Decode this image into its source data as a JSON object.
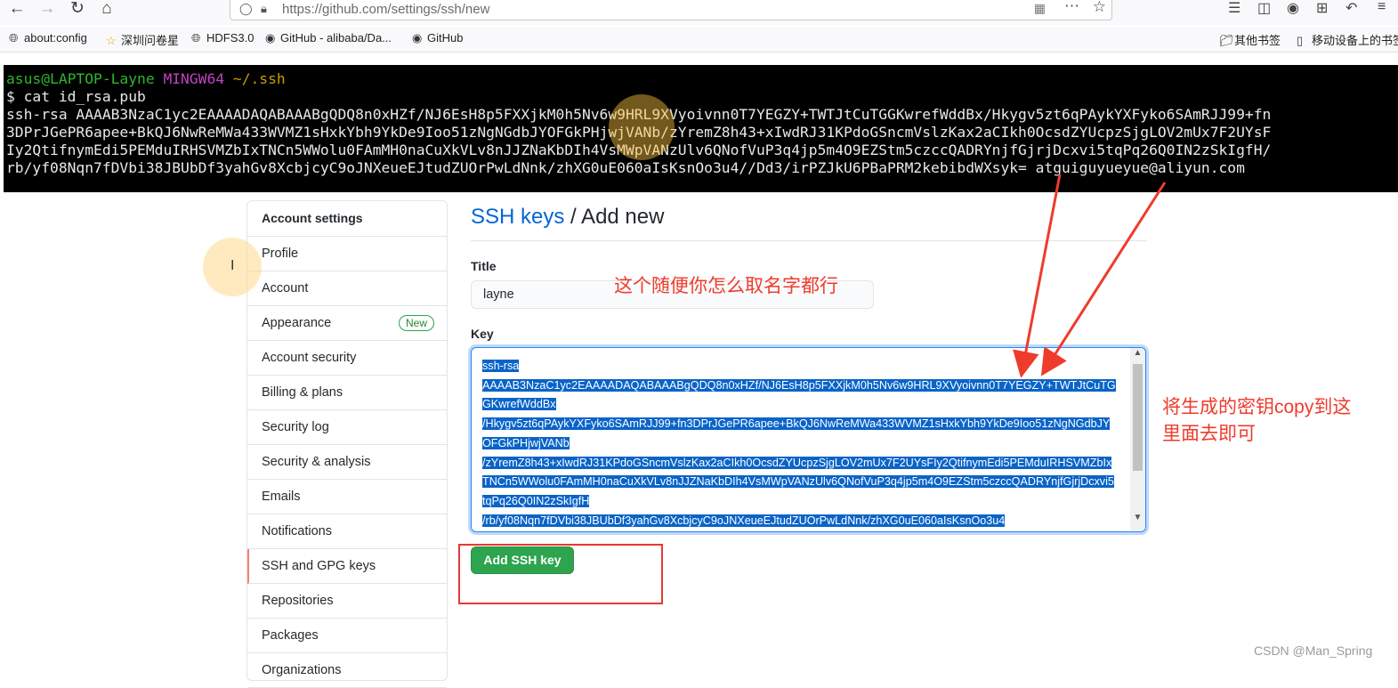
{
  "browser": {
    "url": "https://github.com/settings/ssh/new",
    "bookmarks": [
      "about:config",
      "深圳问卷星",
      "HDFS3.0",
      "GitHub - alibaba/Da...",
      "GitHub"
    ],
    "bookmarks_right": [
      "其他书签",
      "移动设备上的书签"
    ]
  },
  "terminal": {
    "prompt_user": "asus@LAPTOP-Layne",
    "prompt_sys": "MINGW64",
    "prompt_path": "~/.ssh",
    "command": "$ cat id_rsa.pub",
    "output_lines": [
      "ssh-rsa AAAAB3NzaC1yc2EAAAADAQABAAABgQDQ8n0xHZf/NJ6EsH8p5FXXjkM0h5Nv6w9HRL9XVyoivnn0T7YEGZY+TWTJtCuTGGKwrefWddBx/Hkygv5zt6qPAykYXFyko6SAmRJJ99+fn",
      "3DPrJGePR6apee+BkQJ6NwReMWa433WVMZ1sHxkYbh9YkDe9Ioo51zNgNGdbJYOFGkPHjwjVANb/zYremZ8h43+xIwdRJ31KPdoGSncmVslzKax2aCIkh0OcsdZYUcpzSjgLOV2mUx7F2UYsF",
      "Iy2QtifnymEdi5PEMduIRHSVMZbIxTNCn5WWolu0FAmMH0naCuXkVLv8nJJZNaKbDIh4VsMWpVANzUlv6QNofVuP3q4jp5m4O9EZStm5czccQADRYnjfGjrjDcxvi5tqPq26Q0IN2zSkIgfH/",
      "rb/yf08Nqn7fDVbi38JBUbDf3yahGv8XcbjcyC9oJNXeueEJtudZUOrPwLdNnk/zhXG0uE060aIsKsnOo3u4//Dd3/irPZJkU6PBaPRM2kebibdWXsyk= atguiguyueyue@aliyun.com"
    ]
  },
  "sidebar": {
    "header": "Account settings",
    "items": [
      {
        "label": "Profile"
      },
      {
        "label": "Account"
      },
      {
        "label": "Appearance",
        "badge": "New"
      },
      {
        "label": "Account security"
      },
      {
        "label": "Billing & plans"
      },
      {
        "label": "Security log"
      },
      {
        "label": "Security & analysis"
      },
      {
        "label": "Emails"
      },
      {
        "label": "Notifications"
      },
      {
        "label": "SSH and GPG keys",
        "selected": true
      },
      {
        "label": "Repositories"
      },
      {
        "label": "Packages"
      },
      {
        "label": "Organizations"
      }
    ]
  },
  "main": {
    "title_link": "SSH keys",
    "title_rest": " / Add new",
    "title_label": "Title",
    "title_value": "layne",
    "key_label": "Key",
    "key_lines": [
      "ssh-rsa",
      "AAAAB3NzaC1yc2EAAAADAQABAAABgQDQ8n0xHZf/NJ6EsH8p5FXXjkM0h5Nv6w9HRL9XVyoivnn0T7YEGZY+TWTJtCuTGGKwrefWddBx",
      "/Hkygv5zt6qPAykYXFyko6SAmRJJ99+fn3DPrJGePR6apee+BkQJ6NwReMWa433WVMZ1sHxkYbh9YkDe9Ioo51zNgNGdbJYOFGkPHjwjVANb",
      "/zYremZ8h43+xIwdRJ31KPdoGSncmVslzKax2aCIkh0OcsdZYUcpzSjgLOV2mUx7F2UYsFIy2QtifnymEdi5PEMduIRHSVMZbIxTNCn5WWolu0FAmMH0naCuXkVLv8nJJZNaKbDIh4VsMWpVANzUlv6QNofVuP3q4jp5m4O9EZStm5czccQADRYnjfGjrjDcxvi5tqPq26Q0IN2zSkIgfH",
      "/rb/yf08Nqn7fDVbi38JBUbDf3yahGv8XcbjcyC9oJNXeueEJtudZUOrPwLdNnk/zhXG0uE060aIsKsnOo3u4"
    ],
    "add_button": "Add SSH key"
  },
  "annotations": {
    "name_hint": "这个随便你怎么取名字都行",
    "copy_hint_line1": "将生成的密钥copy到这",
    "copy_hint_line2": "里面去即可",
    "color": "#ef3b2c"
  },
  "watermark": "CSDN @Man_Spring"
}
